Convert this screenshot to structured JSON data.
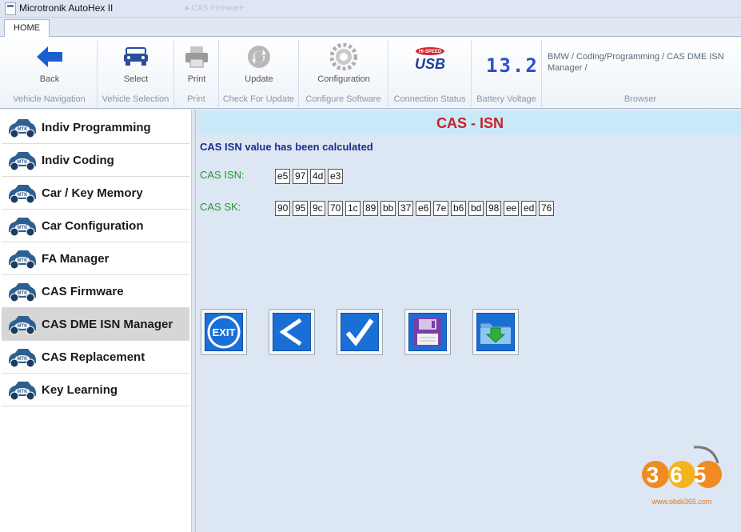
{
  "window": {
    "title": "Microtronik AutoHex II",
    "faded_caption": "▸ CAS Firmware"
  },
  "tabs": [
    {
      "label": "HOME"
    }
  ],
  "ribbon": {
    "groups": [
      {
        "button": "Back",
        "caption": "Vehicle Navigation"
      },
      {
        "button": "Select",
        "caption": "Vehicle Selection"
      },
      {
        "button": "Print",
        "caption": "Print"
      },
      {
        "button": "Update",
        "caption": "Check For Update"
      },
      {
        "button": "Configuration",
        "caption": "Configure Software"
      },
      {
        "button": "",
        "caption": "Connection Status",
        "usb_logo": "USB",
        "usb_tag": "HI-SPEED"
      },
      {
        "button": "",
        "caption": "Battery Voltage",
        "display": "13.2"
      },
      {
        "button": "",
        "caption": "Browser",
        "breadcrumb": "BMW / Coding/Programming / CAS DME ISN Manager /"
      }
    ]
  },
  "sidebar": {
    "items": [
      {
        "label": "Indiv Programming",
        "active": false
      },
      {
        "label": "Indiv Coding",
        "active": false
      },
      {
        "label": "Car / Key Memory",
        "active": false
      },
      {
        "label": "Car Configuration",
        "active": false
      },
      {
        "label": "FA Manager",
        "active": false
      },
      {
        "label": "CAS Firmware",
        "active": false
      },
      {
        "label": "CAS DME ISN Manager",
        "active": true
      },
      {
        "label": "CAS Replacement",
        "active": false
      },
      {
        "label": "Key Learning",
        "active": false
      }
    ],
    "icon_text": "MTK"
  },
  "main": {
    "header": "CAS - ISN",
    "message": "CAS ISN value has been calculated",
    "cas_isn": {
      "label": "CAS ISN:",
      "bytes": [
        "e5",
        "97",
        "4d",
        "e3"
      ]
    },
    "cas_sk": {
      "label": "CAS SK:",
      "bytes": [
        "90",
        "95",
        "9c",
        "70",
        "1c",
        "89",
        "bb",
        "37",
        "e6",
        "7e",
        "b6",
        "bd",
        "98",
        "ee",
        "ed",
        "76"
      ]
    },
    "actions": [
      {
        "name": "exit",
        "icon": "exit-icon",
        "text": "EXIT"
      },
      {
        "name": "back",
        "icon": "chevron-left-icon"
      },
      {
        "name": "confirm",
        "icon": "checkmark-icon"
      },
      {
        "name": "save",
        "icon": "floppy-disk-icon"
      },
      {
        "name": "load",
        "icon": "folder-download-icon"
      }
    ]
  },
  "watermark": {
    "text": "365",
    "url": "www.obdii365.com"
  },
  "colors": {
    "header_text": "#c8202a",
    "header_bg": "#c9e9f9",
    "message": "#1b2d8c",
    "field_label": "#1b9a2a",
    "action_blue": "#1a6fd6",
    "active_item": "#d6d6d6"
  }
}
